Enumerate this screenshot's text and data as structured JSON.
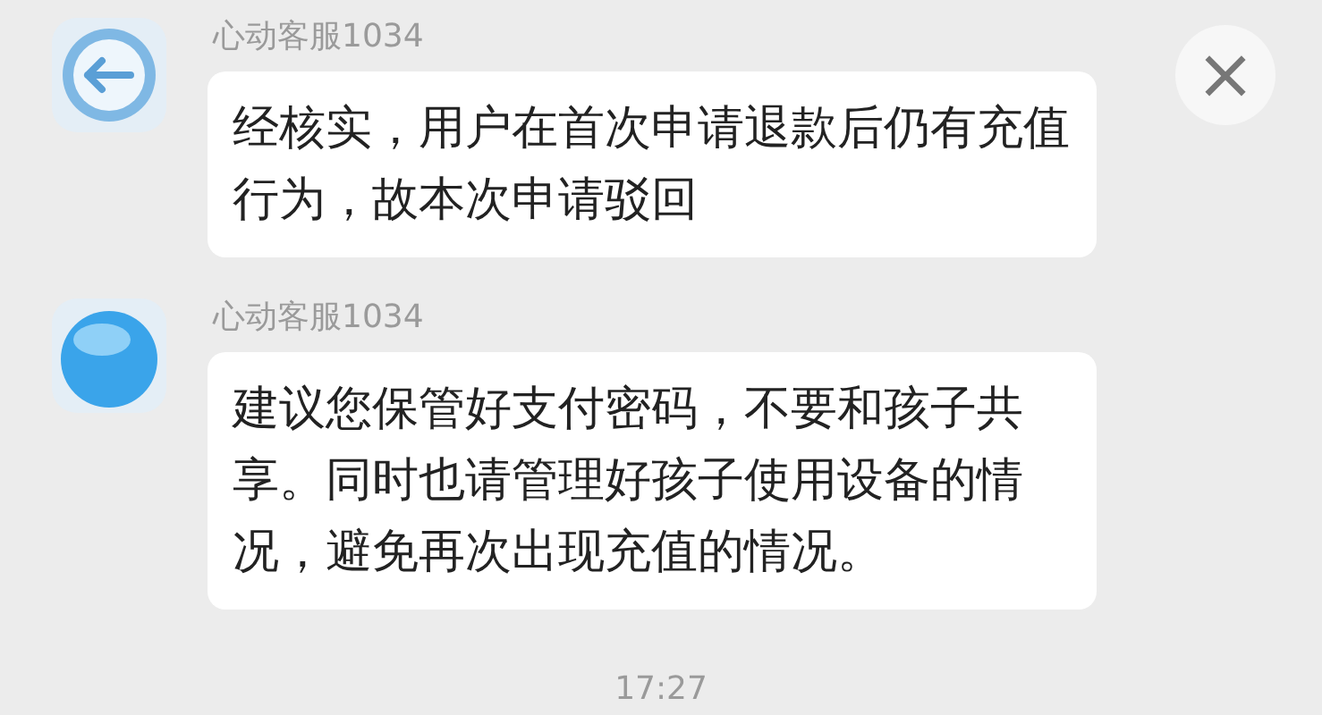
{
  "messages": [
    {
      "sender": "心动客服1034",
      "text": "经核实，用户在首次申请退款后仍有充值行为，故本次申请驳回",
      "kind": "arrow"
    },
    {
      "sender": "心动客服1034",
      "text": "建议您保管好支付密码，不要和孩子共享。同时也请管理好孩子使用设备的情况，避免再次出现充值的情况。",
      "kind": "round"
    }
  ],
  "close_button": "×",
  "time": "17:27"
}
